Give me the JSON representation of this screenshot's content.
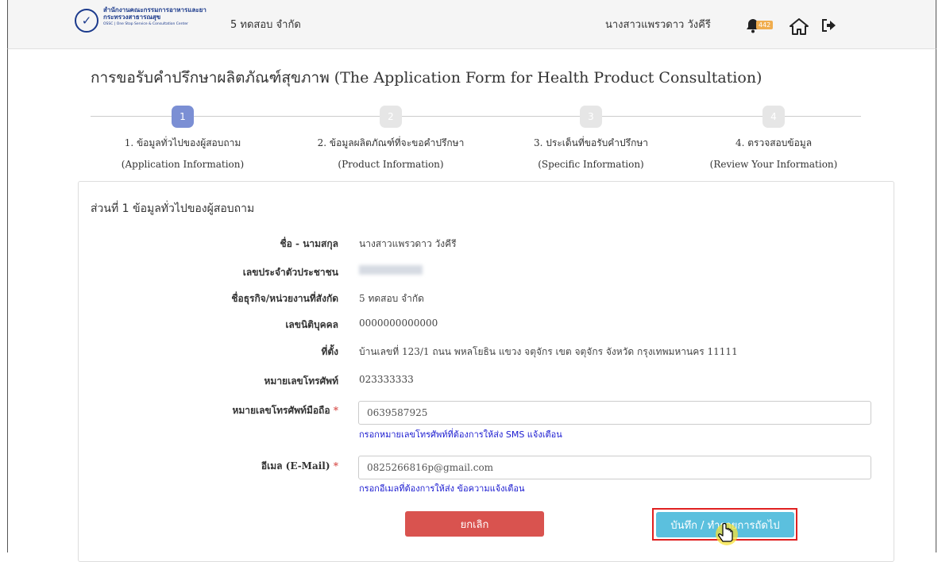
{
  "header": {
    "logo_line1": "สำนักงานคณะกรรมการอาหารและยา",
    "logo_line2": "กระทรวงสาธารณสุข",
    "logo_line3": "OSSC | One Stop Service & Consultation Center",
    "company": "5 ทดสอบ จำกัด",
    "user_name": "นางสาวแพรวดาว วังคีรี",
    "notification_count": "442",
    "icons": [
      "bell-icon",
      "home-icon",
      "logout-icon"
    ]
  },
  "page": {
    "title": "การขอรับคำปรึกษาผลิตภัณฑ์สุขภาพ (The Application Form for Health Product Consultation)"
  },
  "steps": [
    {
      "num": "1",
      "label": "1. ข้อมูลทั่วไปของผู้สอบถาม",
      "sub": "(Application Information)",
      "active": true
    },
    {
      "num": "2",
      "label": "2. ข้อมูลผลิตภัณฑ์ที่จะขอคำปรึกษา",
      "sub": "(Product Information)",
      "active": false
    },
    {
      "num": "3",
      "label": "3. ประเด็นที่ขอรับคำปรึกษา",
      "sub": "(Specific Information)",
      "active": false
    },
    {
      "num": "4",
      "label": "4. ตรวจสอบข้อมูล",
      "sub": "(Review Your Information)",
      "active": false
    }
  ],
  "section": {
    "title": "ส่วนที่ 1 ข้อมูลทั่วไปของผู้สอบถาม"
  },
  "fields": {
    "name_label": "ชื่อ - นามสกุล",
    "name_value": "นางสาวแพรวดาว วังคีรี",
    "id_label": "เลขประจำตัวประชาชน",
    "business_label": "ชื่อธุรกิจ/หน่วยงานที่สังกัด",
    "business_value": "5 ทดสอบ จำกัด",
    "juristic_label": "เลขนิติบุคคล",
    "juristic_value": "0000000000000",
    "address_label": "ที่ตั้ง",
    "address_value": "บ้านเลขที่ 123/1 ถนน พหลโยธิน แขวง จตุจักร เขต จตุจักร จังหวัด กรุงเทพมหานคร 11111",
    "phone_label": "หมายเลขโทรศัพท์",
    "phone_value": "023333333",
    "mobile_label": "หมายเลขโทรศัพท์มือถือ",
    "mobile_value": "0639587925",
    "mobile_hint": "กรอกหมายเลขโทรศัพท์ที่ต้องการให้ส่ง SMS แจ้งเตือน",
    "email_label": "อีเมล (E-Mail)",
    "email_value": "0825266816p@gmail.com",
    "email_hint": "กรอกอีเมลที่ต้องการให้ส่ง ข้อความแจ้งเตือน",
    "required_mark": "*"
  },
  "buttons": {
    "cancel": "ยกเลิก",
    "next": "บันทึก / ทำรายการถัดไป"
  },
  "colors": {
    "active_step": "#7b8fd4",
    "cancel": "#d9534f",
    "next": "#5bc0de",
    "hint": "#1a1ad0",
    "highlight": "#e02020"
  }
}
